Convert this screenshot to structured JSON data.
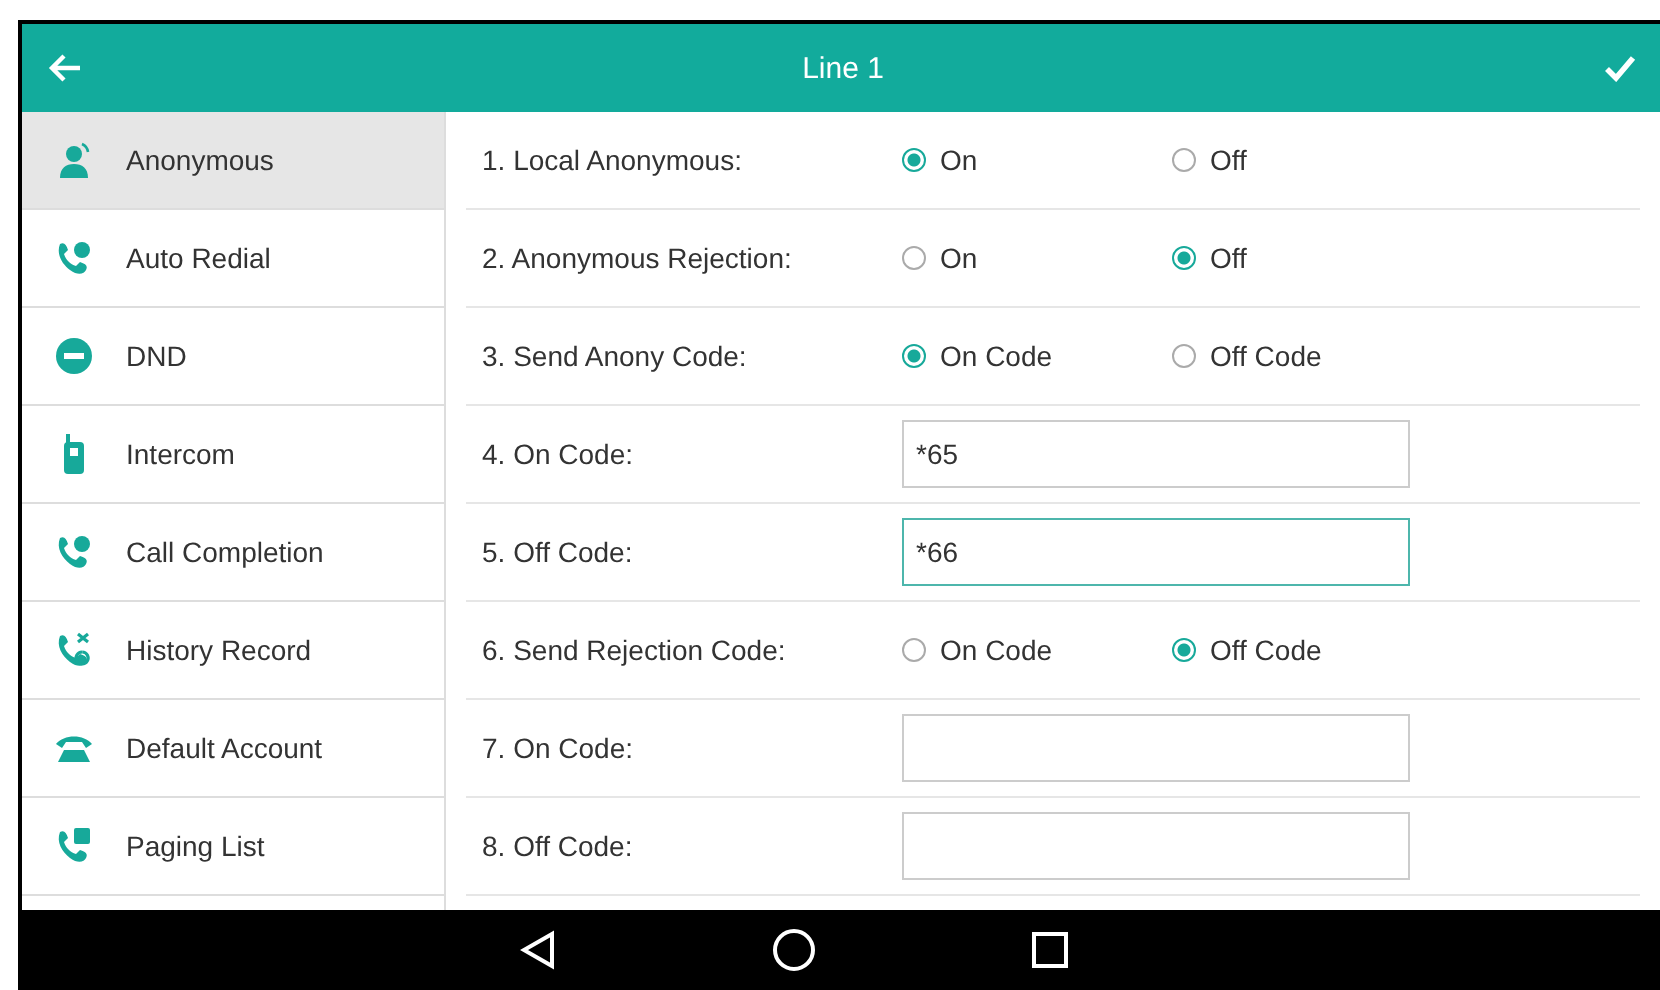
{
  "header": {
    "title": "Line 1"
  },
  "sidebar": {
    "items": [
      {
        "label": "Anonymous",
        "selected": true
      },
      {
        "label": "Auto Redial",
        "selected": false
      },
      {
        "label": "DND",
        "selected": false
      },
      {
        "label": "Intercom",
        "selected": false
      },
      {
        "label": "Call Completion",
        "selected": false
      },
      {
        "label": "History Record",
        "selected": false
      },
      {
        "label": "Default Account",
        "selected": false
      },
      {
        "label": "Paging List",
        "selected": false
      }
    ]
  },
  "settings": [
    {
      "kind": "radio",
      "label": "1. Local Anonymous:",
      "options": [
        {
          "label": "On",
          "selected": true
        },
        {
          "label": "Off",
          "selected": false
        }
      ]
    },
    {
      "kind": "radio",
      "label": "2. Anonymous Rejection:",
      "options": [
        {
          "label": "On",
          "selected": false
        },
        {
          "label": "Off",
          "selected": true
        }
      ]
    },
    {
      "kind": "radio",
      "label": "3. Send Anony Code:",
      "options": [
        {
          "label": "On Code",
          "selected": true
        },
        {
          "label": "Off Code",
          "selected": false
        }
      ]
    },
    {
      "kind": "input",
      "label": "4. On Code:",
      "value": "*65",
      "focused": false
    },
    {
      "kind": "input",
      "label": "5. Off Code:",
      "value": "*66",
      "focused": true
    },
    {
      "kind": "radio",
      "label": "6. Send Rejection Code:",
      "options": [
        {
          "label": "On Code",
          "selected": false
        },
        {
          "label": "Off Code",
          "selected": true
        }
      ]
    },
    {
      "kind": "input",
      "label": "7. On Code:",
      "focused": false
    },
    {
      "kind": "input",
      "label": "8. Off Code:",
      "focused": false
    }
  ]
}
